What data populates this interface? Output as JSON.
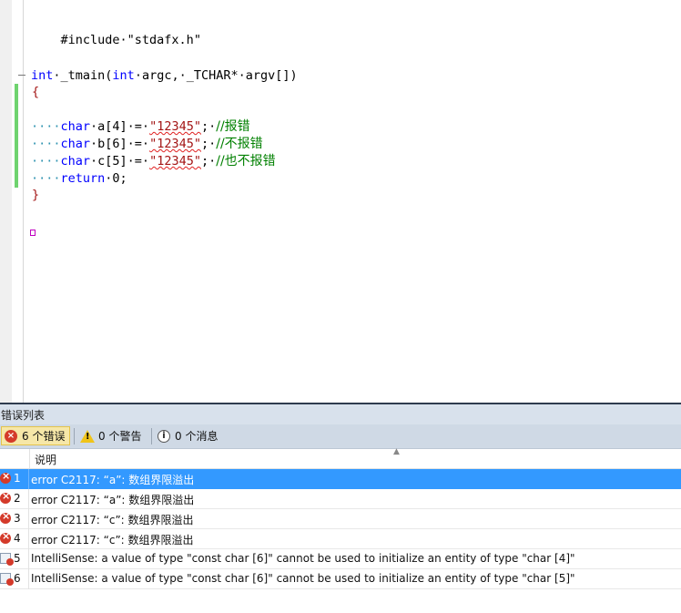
{
  "code": {
    "include_line": "#include·\"stdafx.h\"",
    "main_kw": "int",
    "main_rest": "·_tmain(",
    "main_kw2": "int",
    "main_rest2": "·argc,·_TCHAR*·argv[])",
    "open_brace": "{",
    "lines": [
      {
        "indent": "····",
        "type": "char",
        "decl": "·a[4]·=·",
        "string": "\"12345\"",
        "semi": ";·",
        "comment": "//报错"
      },
      {
        "indent": "····",
        "type": "char",
        "decl": "·b[6]·=·",
        "string": "\"12345\"",
        "semi": ";·",
        "comment": "//不报错"
      },
      {
        "indent": "····",
        "type": "char",
        "decl": "·c[5]·=·",
        "string": "\"12345\"",
        "semi": ";·",
        "comment": "//也不报错"
      }
    ],
    "return_indent": "····",
    "return_kw": "return",
    "return_rest": "·0;",
    "close_brace": "}"
  },
  "error_list": {
    "title": "错误列表",
    "toolbar": {
      "errors_label": "6 个错误",
      "warnings_label": "0 个警告",
      "messages_label": "0 个消息"
    },
    "column_header": "说明",
    "rows": [
      {
        "num": "1",
        "kind": "error",
        "desc": "error C2117: “a”: 数组界限溢出"
      },
      {
        "num": "2",
        "kind": "error",
        "desc": "error C2117: “a”: 数组界限溢出"
      },
      {
        "num": "3",
        "kind": "error",
        "desc": "error C2117: “c”: 数组界限溢出"
      },
      {
        "num": "4",
        "kind": "error",
        "desc": "error C2117: “c”: 数组界限溢出"
      },
      {
        "num": "5",
        "kind": "intellisense",
        "desc": "IntelliSense: a value of type \"const char [6]\" cannot be used to initialize an entity of type \"char [4]\""
      },
      {
        "num": "6",
        "kind": "intellisense",
        "desc": "IntelliSense: a value of type \"const char [6]\" cannot be used to initialize an entity of type \"char [5]\""
      }
    ]
  },
  "colors": {
    "keyword": "#0000ff",
    "string": "#a31515",
    "comment": "#008000",
    "selection": "#3399ff",
    "error_icon": "#d43a2a"
  }
}
